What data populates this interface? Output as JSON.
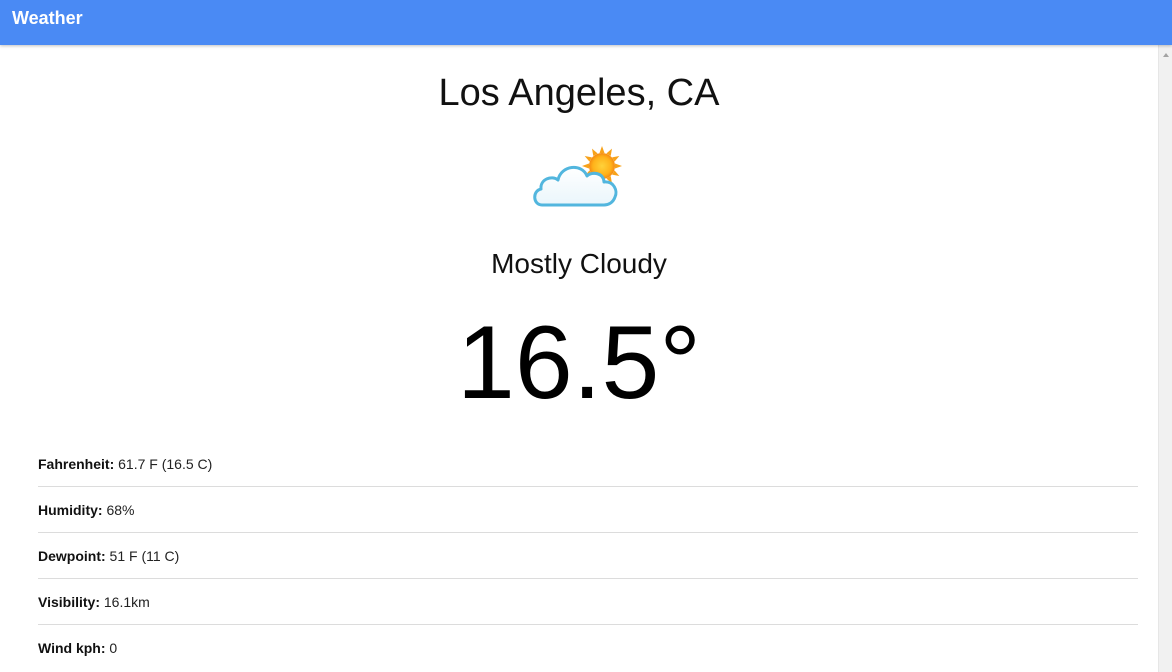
{
  "app_bar": {
    "title": "Weather",
    "color": "#4a8af4"
  },
  "weather": {
    "city": "Los Angeles, CA",
    "icon": "partly-cloudy-icon",
    "condition": "Mostly Cloudy",
    "temperature": "16.5°"
  },
  "details": [
    {
      "label": "Fahrenheit:",
      "value": "61.7 F (16.5 C)"
    },
    {
      "label": "Humidity:",
      "value": "68%"
    },
    {
      "label": "Dewpoint:",
      "value": "51 F (11 C)"
    },
    {
      "label": "Visibility:",
      "value": "16.1km"
    },
    {
      "label": "Wind kph:",
      "value": "0"
    }
  ]
}
